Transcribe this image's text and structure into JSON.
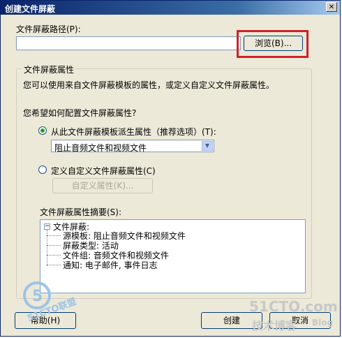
{
  "dialog": {
    "title": "创建文件屏蔽",
    "close_glyph": "✕"
  },
  "path": {
    "label": "文件屏蔽路径(P):",
    "value": "",
    "browse_label": "浏览(B)..."
  },
  "properties": {
    "group_title": "文件屏蔽属性",
    "description": "您可以使用来自文件屏蔽模板的属性，或定义自定义文件屏蔽属性。",
    "question": "您希望如何配置文件屏蔽属性?",
    "option_template": "从此文件屏蔽模板派生属性（推荐选项）(T):",
    "template_selected": "阻止音频文件和视频文件",
    "option_custom": "定义自定义文件屏蔽属性(C)",
    "custom_button": "自定义属性(K)...",
    "summary_label": "文件屏蔽属性摘要(S):",
    "summary": {
      "root": "文件屏蔽:",
      "items": [
        "源模板: 阻止音频文件和视频文件",
        "屏蔽类型: 活动",
        "文件组: 音频文件和视频文件",
        "通知: 电子邮件, 事件日志"
      ]
    }
  },
  "footer": {
    "help_label": "帮助(H)",
    "create_label": "创建",
    "cancel_label": "取消"
  },
  "watermarks": {
    "left_text": "51CTO联盟",
    "right_main": "51CTO.com",
    "right_sub": "技术博客",
    "right_blog": "Blog"
  },
  "colors": {
    "highlight": "#d0222a",
    "title_bar": "#0a246a",
    "dialog_bg": "#ece9d8"
  }
}
